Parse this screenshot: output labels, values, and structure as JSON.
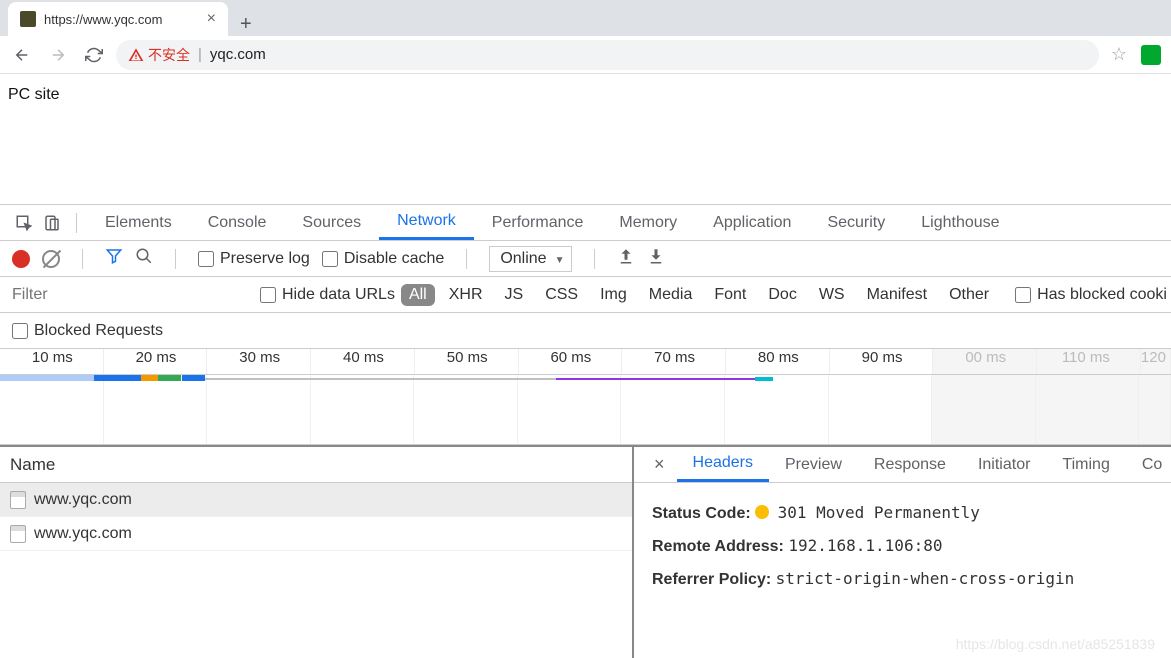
{
  "browser": {
    "tab_title": "https://www.yqc.com",
    "security_label": "不安全",
    "url": "yqc.com"
  },
  "page": {
    "body_text": "PC site"
  },
  "devtools": {
    "tabs": [
      "Elements",
      "Console",
      "Sources",
      "Network",
      "Performance",
      "Memory",
      "Application",
      "Security",
      "Lighthouse"
    ],
    "active_tab": "Network",
    "toolbar": {
      "preserve_log": "Preserve log",
      "disable_cache": "Disable cache",
      "throttle": "Online"
    },
    "filter": {
      "placeholder": "Filter",
      "hide_data_urls": "Hide data URLs",
      "types": [
        "All",
        "XHR",
        "JS",
        "CSS",
        "Img",
        "Media",
        "Font",
        "Doc",
        "WS",
        "Manifest",
        "Other"
      ],
      "active_type": "All",
      "has_blocked": "Has blocked cooki"
    },
    "blocked_requests": "Blocked Requests",
    "timeline_ticks": [
      "10 ms",
      "20 ms",
      "30 ms",
      "40 ms",
      "50 ms",
      "60 ms",
      "70 ms",
      "80 ms",
      "90 ms",
      "00 ms",
      "110 ms",
      "120"
    ],
    "requests": {
      "header": "Name",
      "rows": [
        "www.yqc.com",
        "www.yqc.com"
      ]
    },
    "detail": {
      "tabs": [
        "Headers",
        "Preview",
        "Response",
        "Initiator",
        "Timing",
        "Co"
      ],
      "active_tab": "Headers",
      "status_code_label": "Status Code:",
      "status_code_value": "301 Moved Permanently",
      "remote_address_label": "Remote Address:",
      "remote_address_value": "192.168.1.106:80",
      "referrer_policy_label": "Referrer Policy:",
      "referrer_policy_value": "strict-origin-when-cross-origin"
    }
  },
  "watermark": "https://blog.csdn.net/a85251839"
}
